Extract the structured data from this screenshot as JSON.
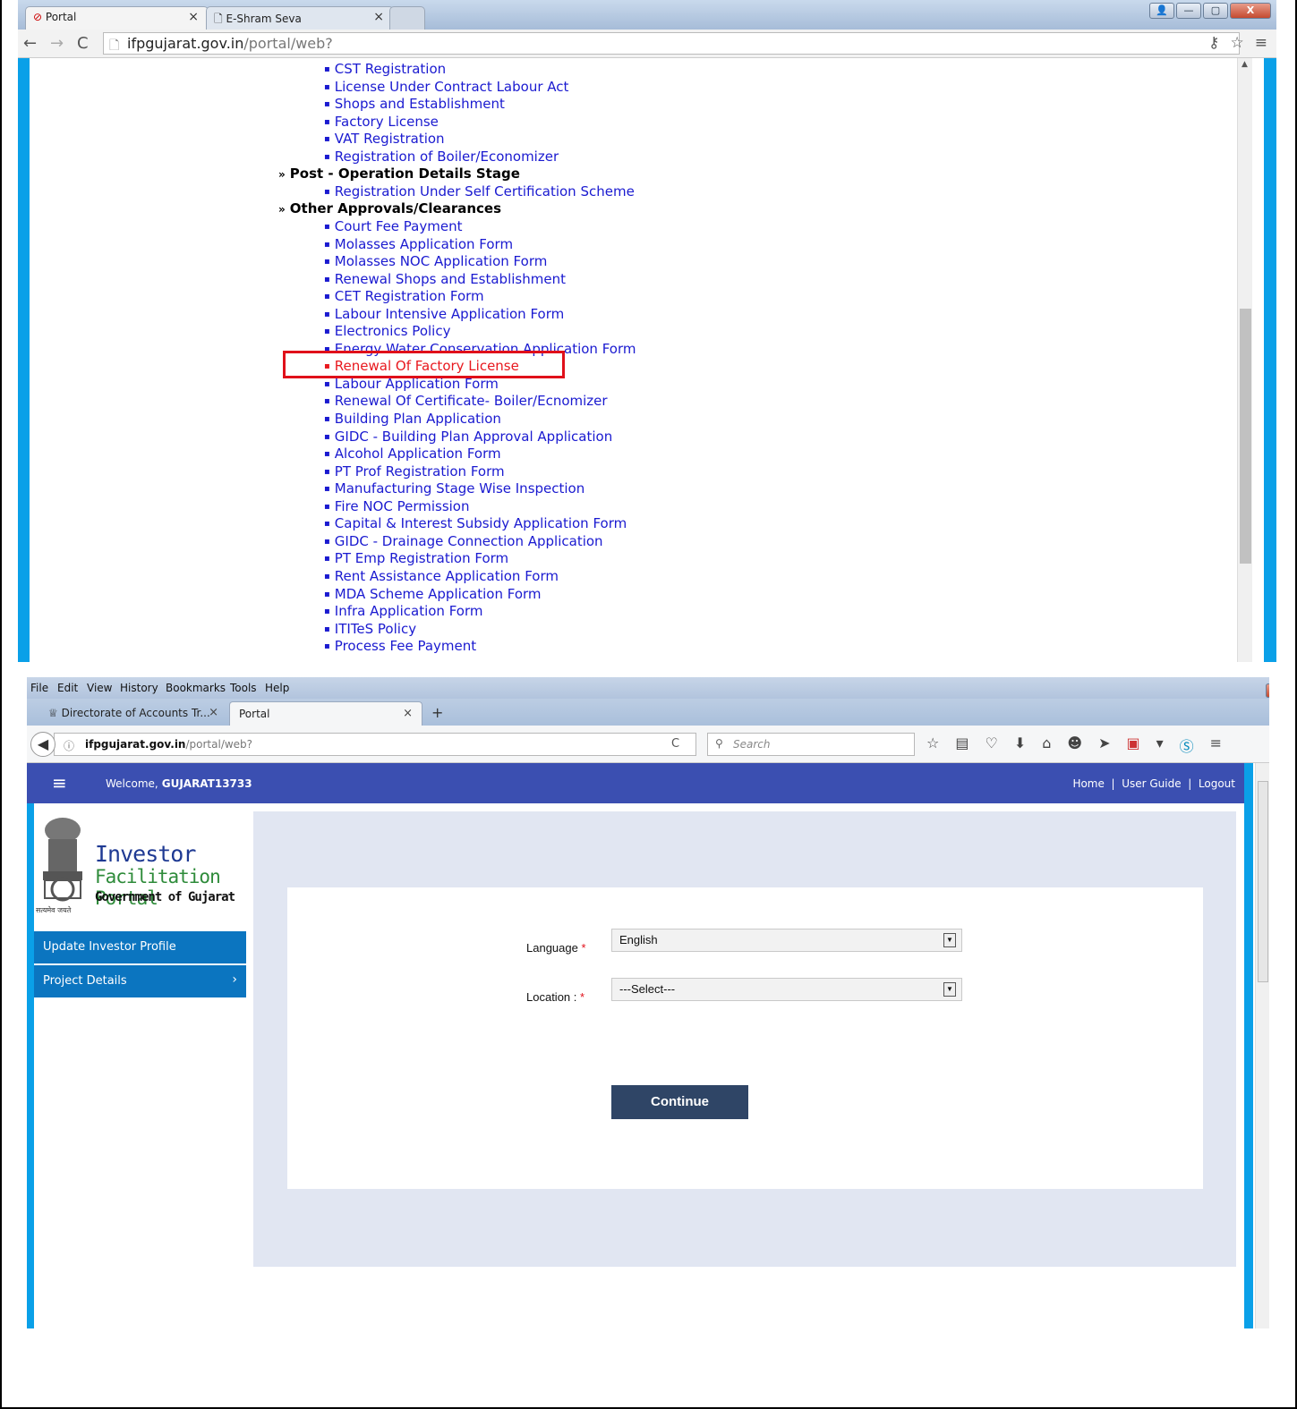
{
  "top_browser": {
    "tabs": [
      {
        "label": "Portal",
        "active": true
      },
      {
        "label": "E-Shram Seva",
        "active": false
      }
    ],
    "url_host": "ifpgujarat.gov.in",
    "url_path": "/portal/web?"
  },
  "menu": {
    "items": [
      {
        "type": "link",
        "label": "CST Registration"
      },
      {
        "type": "link",
        "label": "License Under Contract Labour Act"
      },
      {
        "type": "link",
        "label": "Shops and Establishment"
      },
      {
        "type": "link",
        "label": "Factory License"
      },
      {
        "type": "link",
        "label": "VAT Registration"
      },
      {
        "type": "link",
        "label": "Registration of Boiler/Economizer"
      },
      {
        "type": "heading",
        "label": "Post - Operation Details Stage"
      },
      {
        "type": "link",
        "label": "Registration Under Self Certification Scheme"
      },
      {
        "type": "heading",
        "label": "Other Approvals/Clearances"
      },
      {
        "type": "link",
        "label": "Court Fee Payment"
      },
      {
        "type": "link",
        "label": "Molasses Application Form"
      },
      {
        "type": "link",
        "label": "Molasses NOC Application Form"
      },
      {
        "type": "link",
        "label": "Renewal Shops and Establishment"
      },
      {
        "type": "link",
        "label": "CET Registration Form"
      },
      {
        "type": "link",
        "label": "Labour Intensive Application Form"
      },
      {
        "type": "link",
        "label": "Electronics Policy"
      },
      {
        "type": "link",
        "label": "Energy Water Conservation Application Form"
      },
      {
        "type": "link",
        "label": "Renewal Of Factory License",
        "highlighted": true
      },
      {
        "type": "link",
        "label": "Labour Application Form"
      },
      {
        "type": "link",
        "label": "Renewal Of Certificate- Boiler/Ecnomizer"
      },
      {
        "type": "link",
        "label": "Building Plan Application"
      },
      {
        "type": "link",
        "label": "GIDC - Building Plan Approval Application"
      },
      {
        "type": "link",
        "label": "Alcohol Application Form"
      },
      {
        "type": "link",
        "label": "PT Prof Registration Form"
      },
      {
        "type": "link",
        "label": "Manufacturing Stage Wise Inspection"
      },
      {
        "type": "link",
        "label": "Fire NOC Permission"
      },
      {
        "type": "link",
        "label": "Capital & Interest Subsidy Application Form"
      },
      {
        "type": "link",
        "label": "GIDC - Drainage Connection Application"
      },
      {
        "type": "link",
        "label": "PT Emp Registration Form"
      },
      {
        "type": "link",
        "label": "Rent Assistance Application Form"
      },
      {
        "type": "link",
        "label": "MDA Scheme Application Form"
      },
      {
        "type": "link",
        "label": "Infra Application Form"
      },
      {
        "type": "link",
        "label": "ITITeS Policy"
      },
      {
        "type": "link",
        "label": "Process Fee Payment"
      }
    ]
  },
  "bottom_browser": {
    "menubar": [
      "File",
      "Edit",
      "View",
      "History",
      "Bookmarks",
      "Tools",
      "Help"
    ],
    "tabs": [
      {
        "label": "Directorate of Accounts Tr...",
        "active": false
      },
      {
        "label": "Portal",
        "active": true
      }
    ],
    "url_host": "ifpgujarat.gov.in",
    "url_path": "/portal/web?",
    "search_placeholder": "Search"
  },
  "portal": {
    "welcome_prefix": "Welcome,",
    "username": "GUJARAT13733",
    "top_links": [
      "Home",
      "User Guide",
      "Logout"
    ],
    "logo_line1": "Investor",
    "logo_line2": "Facilitation Portal",
    "logo_line3": "Government of Gujarat",
    "logo_motto": "सत्यमेव जयते",
    "side_nav": [
      {
        "label": "Update Investor Profile"
      },
      {
        "label": "Project Details"
      }
    ],
    "form": {
      "language_label": "Language",
      "language_value": "English",
      "location_label": "Location :",
      "location_value": "---Select---",
      "required_mark": "*",
      "continue_label": "Continue"
    }
  },
  "colors": {
    "header_bg": "#3b4fb1",
    "side_nav_bg": "#0b75c0",
    "link_blue": "#1a1ad0",
    "highlight_red": "#e0101a",
    "continue_bg": "#2f4566",
    "panel_bg": "#e1e6f2",
    "frame_cyan": "#0aa0e8"
  }
}
